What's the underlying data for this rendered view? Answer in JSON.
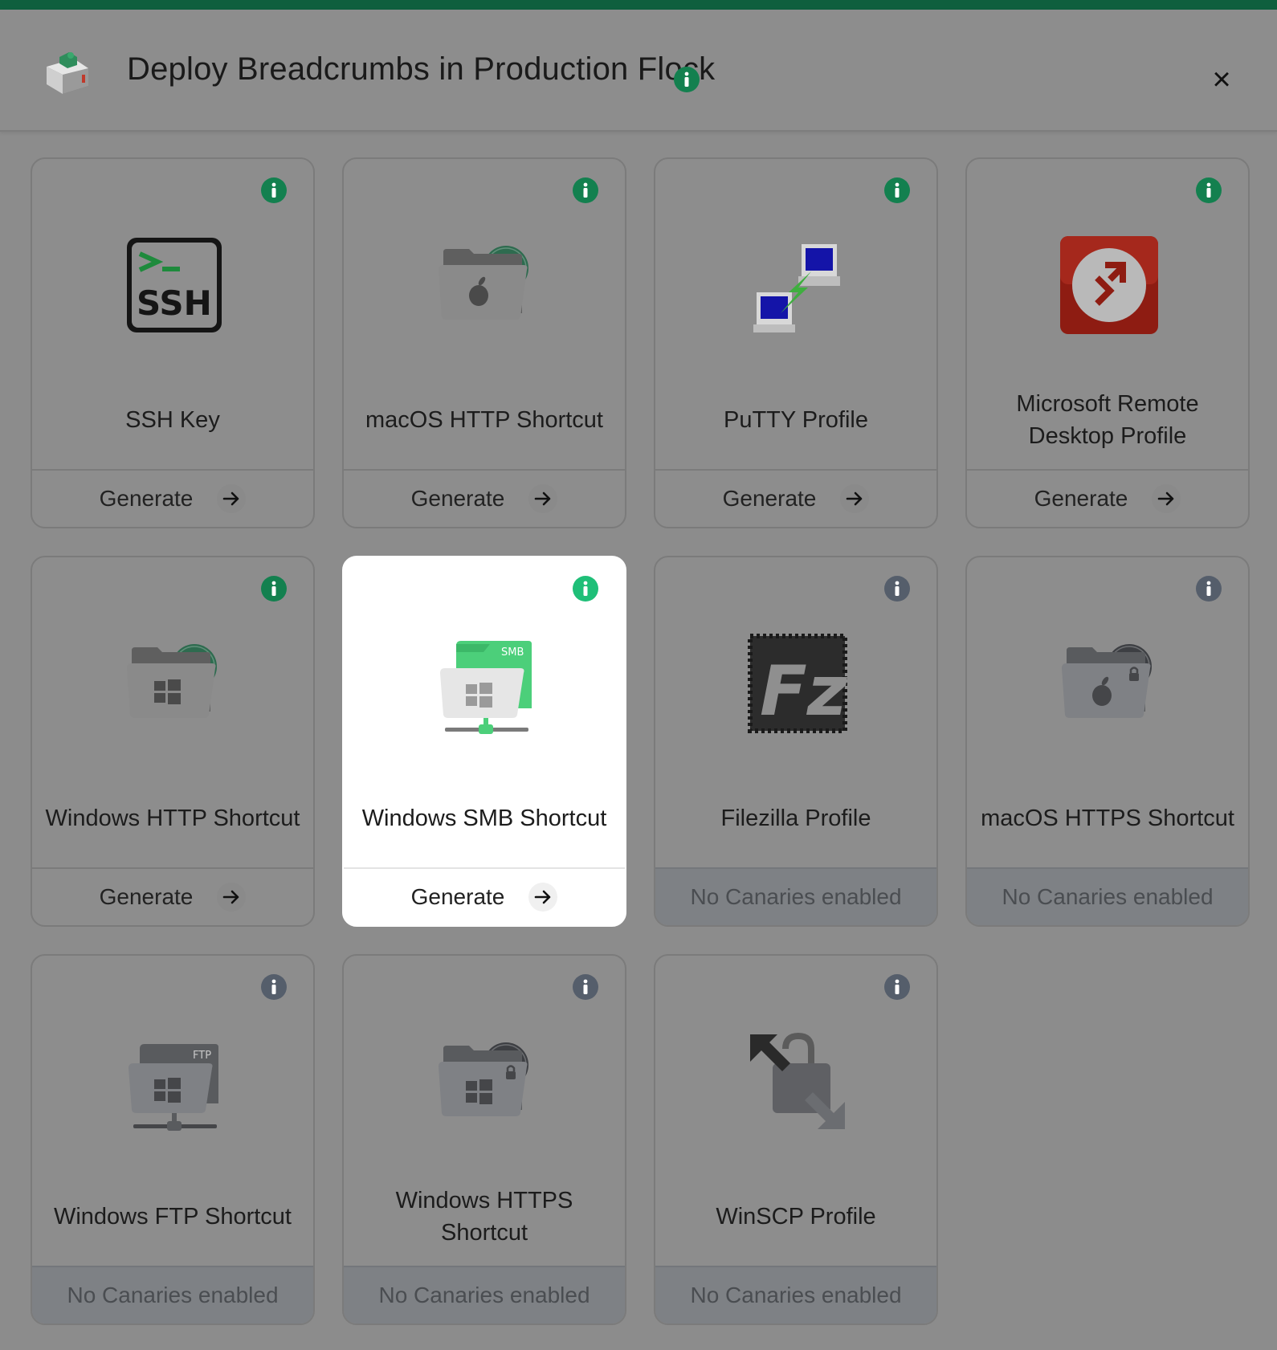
{
  "header": {
    "title": "Deploy Breadcrumbs in Production Flock",
    "logo_icon": "toaster-canary-icon",
    "info_icon": "info-icon",
    "close_label": "×"
  },
  "colors": {
    "brand_green": "#0f5f3e",
    "info_green": "#13804f",
    "info_green_bright": "#1fbf78",
    "info_gray": "#555e6b"
  },
  "cards": [
    {
      "label": "SSH Key",
      "icon": "ssh-terminal-icon",
      "action": "Generate",
      "enabled": true
    },
    {
      "label": "macOS HTTP Shortcut",
      "icon": "macos-http-folder-icon",
      "action": "Generate",
      "enabled": true
    },
    {
      "label": "PuTTY Profile",
      "icon": "putty-computers-icon",
      "action": "Generate",
      "enabled": true
    },
    {
      "label": "Microsoft Remote Desktop Profile",
      "icon": "remote-desktop-icon",
      "action": "Generate",
      "enabled": true
    },
    {
      "label": "Windows HTTP Shortcut",
      "icon": "windows-http-folder-icon",
      "action": "Generate",
      "enabled": true
    },
    {
      "label": "Windows SMB Shortcut",
      "icon": "windows-smb-folder-icon",
      "action": "Generate",
      "enabled": true,
      "active": true
    },
    {
      "label": "Filezilla Profile",
      "icon": "filezilla-icon",
      "action": "No Canaries enabled",
      "enabled": false
    },
    {
      "label": "macOS HTTPS Shortcut",
      "icon": "macos-https-folder-icon",
      "action": "No Canaries enabled",
      "enabled": false
    },
    {
      "label": "Windows FTP Shortcut",
      "icon": "windows-ftp-folder-icon",
      "action": "No Canaries enabled",
      "enabled": false
    },
    {
      "label": "Windows HTTPS Shortcut",
      "icon": "windows-https-folder-icon",
      "action": "No Canaries enabled",
      "enabled": false
    },
    {
      "label": "WinSCP Profile",
      "icon": "winscp-icon",
      "action": "No Canaries enabled",
      "enabled": false
    }
  ],
  "folder_tags": {
    "smb": "SMB",
    "ftp": "FTP"
  }
}
